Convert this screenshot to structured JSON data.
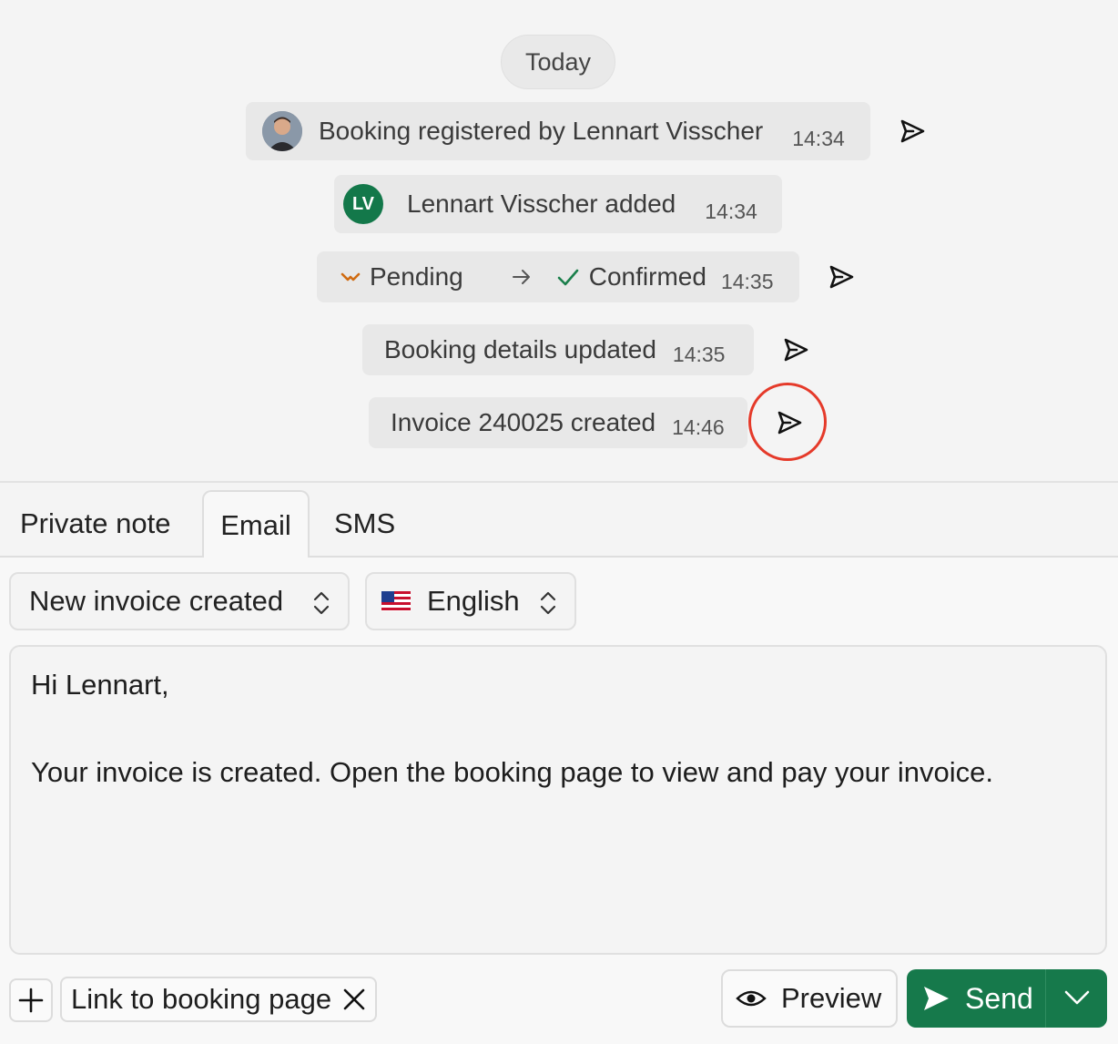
{
  "timeline": {
    "day_label": "Today",
    "events": [
      {
        "text": "Booking registered by Lennart Visscher",
        "time": "14:34"
      },
      {
        "text": "Lennart Visscher added",
        "time": "14:34",
        "initials": "LV"
      },
      {
        "from": "Pending",
        "to": "Confirmed",
        "time": "14:35"
      },
      {
        "text": "Booking details updated",
        "time": "14:35"
      },
      {
        "text": "Invoice 240025 created",
        "time": "14:46"
      }
    ]
  },
  "tabs": [
    "Private note",
    "Email",
    "SMS"
  ],
  "active_tab": "Email",
  "composer": {
    "template": "New invoice created",
    "language": "English",
    "body_greeting": "Hi Lennart,",
    "body_text": "Your invoice is created. Open the booking page to view and pay your invoice.",
    "attachment_chip": "Link to booking page",
    "preview_label": "Preview",
    "send_label": "Send"
  },
  "colors": {
    "accent_green": "#16794b",
    "highlight_red": "#e53a2a",
    "pending_orange": "#d06b12",
    "confirmed_green": "#1a7f4b"
  },
  "icons": [
    "send-icon",
    "arrow-right-icon",
    "check-icon",
    "chevron-updown-icon",
    "flag-us-icon",
    "plus-icon",
    "close-icon",
    "eye-icon",
    "chevron-down-icon"
  ]
}
